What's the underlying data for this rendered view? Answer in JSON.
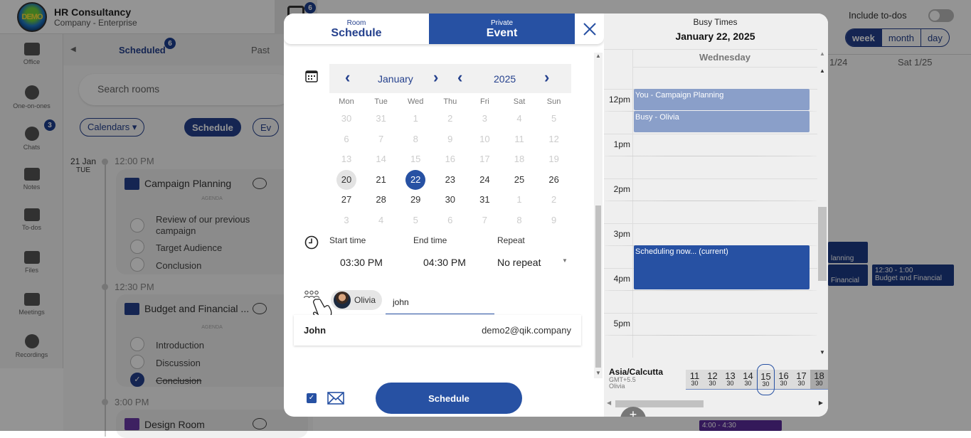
{
  "app": {
    "company_name": "HR Consultancy",
    "company_plan": "Company - Enterprise",
    "logo_text": "DEMO",
    "calendar_badge": "6"
  },
  "sidebar": {
    "items": [
      {
        "label": "Office",
        "icon": "briefcase-icon"
      },
      {
        "label": "One-on-ones",
        "icon": "people-icon"
      },
      {
        "label": "Chats",
        "icon": "chat-icon",
        "badge": "3"
      },
      {
        "label": "Notes",
        "icon": "notes-icon"
      },
      {
        "label": "To-dos",
        "icon": "todo-icon"
      },
      {
        "label": "Files",
        "icon": "files-icon"
      },
      {
        "label": "Meetings",
        "icon": "meetings-icon"
      },
      {
        "label": "Recordings",
        "icon": "recordings-icon"
      }
    ]
  },
  "panel": {
    "tab_scheduled": "Scheduled",
    "tab_scheduled_badge": "6",
    "tab_past": "Past",
    "search_placeholder": "Search rooms",
    "calendars_button": "Calendars ▾",
    "schedule_button": "Schedule",
    "event_button": "Ev",
    "date_day": "21 Jan",
    "date_weekday": "TUE",
    "agenda_label": "AGENDA",
    "events": [
      {
        "time": "12:00 PM",
        "repeat": true,
        "title": "Campaign Planning",
        "agenda": [
          {
            "text": "Review of our previous campaign",
            "done": false
          },
          {
            "text": "Target Audience",
            "done": false
          },
          {
            "text": "Conclusion",
            "done": false
          }
        ]
      },
      {
        "time": "12:30 PM",
        "repeat": true,
        "title": "Budget and Financial ...",
        "agenda": [
          {
            "text": "Introduction",
            "done": false
          },
          {
            "text": "Discussion",
            "done": false
          },
          {
            "text": "Conclusion",
            "done": true
          }
        ]
      },
      {
        "time": "3:00 PM",
        "repeat": false,
        "title": "Design Room"
      }
    ]
  },
  "calendar_view": {
    "include_todos_label": "Include to-dos",
    "include_todos": false,
    "view_modes": [
      "week",
      "month",
      "day"
    ],
    "active_view": "week",
    "col_headers": [
      "1/24",
      "Sat 1/25"
    ],
    "events": [
      {
        "text": "lanning"
      },
      {
        "text": "Financial"
      },
      {
        "time": "12:30 - 1:00",
        "text": "Budget and Financial"
      },
      {
        "time": "4:00 - 4:30"
      }
    ]
  },
  "modal": {
    "tab_room_small": "Room",
    "tab_room_large": "Schedule",
    "tab_event_small": "Private",
    "tab_event_large": "Event",
    "month": "January",
    "year": "2025",
    "weekdays": [
      "Mon",
      "Tue",
      "Wed",
      "Thu",
      "Fri",
      "Sat",
      "Sun"
    ],
    "weeks": [
      [
        {
          "d": "30",
          "m": true
        },
        {
          "d": "31",
          "m": true
        },
        {
          "d": "1",
          "m": true
        },
        {
          "d": "2",
          "m": true
        },
        {
          "d": "3",
          "m": true
        },
        {
          "d": "4",
          "m": true
        },
        {
          "d": "5",
          "m": true
        }
      ],
      [
        {
          "d": "6",
          "m": true
        },
        {
          "d": "7",
          "m": true
        },
        {
          "d": "8",
          "m": true
        },
        {
          "d": "9",
          "m": true
        },
        {
          "d": "10",
          "m": true
        },
        {
          "d": "11",
          "m": true
        },
        {
          "d": "12",
          "m": true
        }
      ],
      [
        {
          "d": "13",
          "m": true
        },
        {
          "d": "14",
          "m": true
        },
        {
          "d": "15",
          "m": true
        },
        {
          "d": "16",
          "m": true
        },
        {
          "d": "17",
          "m": true
        },
        {
          "d": "18",
          "m": true
        },
        {
          "d": "19",
          "m": true
        }
      ],
      [
        {
          "d": "20",
          "today": true
        },
        {
          "d": "21"
        },
        {
          "d": "22",
          "sel": true
        },
        {
          "d": "23"
        },
        {
          "d": "24"
        },
        {
          "d": "25"
        },
        {
          "d": "26"
        }
      ],
      [
        {
          "d": "27"
        },
        {
          "d": "28"
        },
        {
          "d": "29"
        },
        {
          "d": "30"
        },
        {
          "d": "31"
        },
        {
          "d": "1",
          "m": true
        },
        {
          "d": "2",
          "m": true
        }
      ],
      [
        {
          "d": "3",
          "m": true
        },
        {
          "d": "4",
          "m": true
        },
        {
          "d": "5",
          "m": true
        },
        {
          "d": "6",
          "m": true
        },
        {
          "d": "7",
          "m": true
        },
        {
          "d": "8",
          "m": true
        },
        {
          "d": "9",
          "m": true
        }
      ]
    ],
    "start_time_label": "Start time",
    "start_time": "03:30 PM",
    "end_time_label": "End time",
    "end_time": "04:30 PM",
    "repeat_label": "Repeat",
    "repeat_value": "No repeat",
    "attendee_chip": "Olivia",
    "invite_input_value": "john",
    "suggestion_name": "John",
    "suggestion_email": "demo2@qik.company",
    "email_notify_checked": true,
    "schedule_button": "Schedule"
  },
  "busy": {
    "title": "Busy Times",
    "date": "January 22, 2025",
    "weekday": "Wednesday",
    "hours": [
      "12pm",
      "1pm",
      "2pm",
      "3pm",
      "4pm",
      "5pm"
    ],
    "events": [
      {
        "label": "You - Campaign Planning",
        "kind": "light"
      },
      {
        "label": "Busy - Olivia",
        "kind": "light"
      },
      {
        "label": "Scheduling now... (current)",
        "kind": "current"
      }
    ],
    "timezone_name": "Asia/Calcutta",
    "timezone_offset": "GMT+5.5",
    "timezone_person": "Olivia",
    "hour_strip": [
      {
        "h": "11",
        "m": "30"
      },
      {
        "h": "12",
        "m": "30"
      },
      {
        "h": "13",
        "m": "30"
      },
      {
        "h": "14",
        "m": "30"
      },
      {
        "h": "15",
        "m": "30",
        "current": true
      },
      {
        "h": "16",
        "m": "30"
      },
      {
        "h": "17",
        "m": "30"
      },
      {
        "h": "18",
        "m": "30",
        "dark": true
      }
    ]
  }
}
